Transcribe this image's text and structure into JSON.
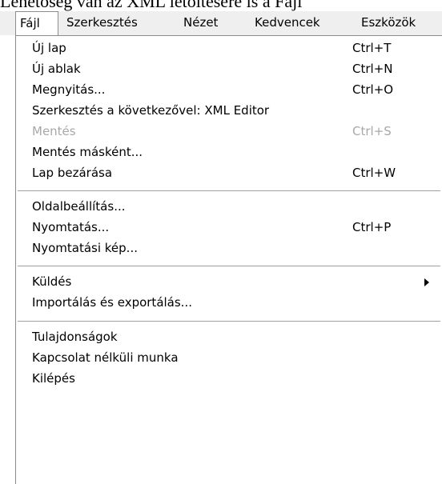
{
  "top_text": "Lehetőség van az XML letöltésére is a Fájl",
  "menubar": {
    "items": [
      "Fájl",
      "Szerkesztés",
      "Nézet",
      "Kedvencek",
      "Eszközök"
    ]
  },
  "menu": {
    "groups": [
      [
        {
          "label": "Új lap",
          "shortcut": "Ctrl+T"
        },
        {
          "label": "Új ablak",
          "shortcut": "Ctrl+N"
        },
        {
          "label": "Megnyitás...",
          "shortcut": "Ctrl+O"
        },
        {
          "label": "Szerkesztés a következővel: XML Editor",
          "shortcut": ""
        },
        {
          "label": "Mentés",
          "shortcut": "Ctrl+S",
          "disabled": true
        },
        {
          "label": "Mentés másként...",
          "shortcut": ""
        },
        {
          "label": "Lap bezárása",
          "shortcut": "Ctrl+W"
        }
      ],
      [
        {
          "label": "Oldalbeállítás...",
          "shortcut": ""
        },
        {
          "label": "Nyomtatás...",
          "shortcut": "Ctrl+P"
        },
        {
          "label": "Nyomtatási kép...",
          "shortcut": ""
        }
      ],
      [
        {
          "label": "Küldés",
          "shortcut": "",
          "submenu": true
        },
        {
          "label": "Importálás és exportálás...",
          "shortcut": ""
        }
      ],
      [
        {
          "label": "Tulajdonságok",
          "shortcut": ""
        },
        {
          "label": "Kapcsolat nélküli munka",
          "shortcut": ""
        },
        {
          "label": "Kilépés",
          "shortcut": ""
        }
      ]
    ]
  },
  "colors": {
    "menubar_bg": "#efefef",
    "menu_bg": "#ffffff",
    "disabled_text": "#a8a8a8",
    "border": "#8c8c8c"
  }
}
